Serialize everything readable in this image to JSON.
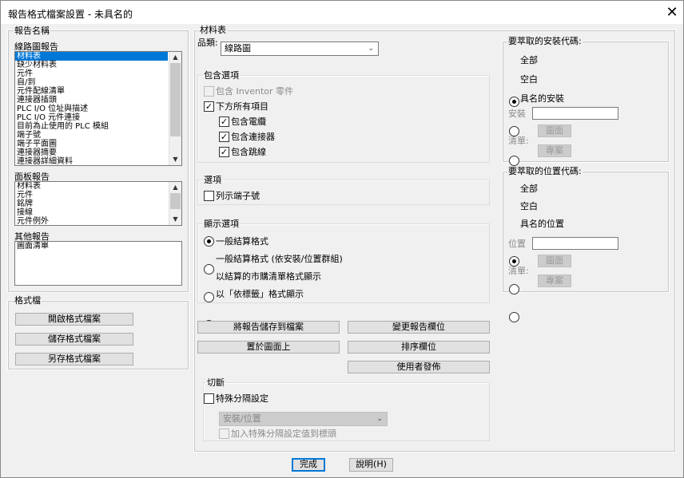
{
  "window": {
    "title": "報告格式檔案設置 - 未具名的",
    "close_glyph": "✕"
  },
  "report_names": {
    "group_label": "報告名稱",
    "circuit": {
      "label": "線路圖報告",
      "items": [
        "材料表",
        "缺少材料表",
        "元件",
        "自/到",
        "元件配線清單",
        "連接器插頭",
        "PLC I/O 位址與描述",
        "PLC I/O 元件連接",
        "目前為止使用的 PLC 模組",
        "端子號",
        "端子平面圖",
        "連接器摘要",
        "連接器詳細資料"
      ],
      "selected_index": 0
    },
    "panel": {
      "label": "面板報告",
      "items": [
        "材料表",
        "元件",
        "銘牌",
        "接線",
        "元件例外"
      ]
    },
    "other": {
      "label": "其他報告",
      "items": [
        "圖面清單"
      ]
    }
  },
  "format_file": {
    "group_label": "格式檔",
    "open": "開啟格式檔案",
    "save": "儲存格式檔案",
    "save_as": "另存格式檔案"
  },
  "bom": {
    "title": "材料表",
    "category_label": "品類:",
    "category_value": "線路圖",
    "include_group": "包含選項",
    "include_inventor": "包含 Inventor 零件",
    "include_below": "下方所有項目",
    "include_cables": "包含電纜",
    "include_connectors": "包含連接器",
    "include_jumpers": "包含跳線",
    "options_group": "選項",
    "list_terminal": "列示端子號",
    "display_group": "顯示選項",
    "display_options": [
      "一般結算格式",
      "一般結算格式 (依安裝/位置群組)",
      "以結算的市購清單格式顯示",
      "以「依標籤」格式顯示"
    ],
    "display_selected": 0
  },
  "buttons": {
    "save_report": "將報告儲存到檔案",
    "change_fields": "變更報告欄位",
    "put_on_drawing": "置於圖面上",
    "sort_fields": "排序欄位",
    "user_post": "使用者發佈"
  },
  "break": {
    "group_label": "切斷",
    "special": "特殊分隔設定",
    "select_value": "安裝/位置",
    "add_value": "加入特殊分隔設定值到標頭"
  },
  "install_codes": {
    "group_label": "要萃取的安裝代碼:",
    "options": [
      "全部",
      "空白",
      "具名的安裝"
    ],
    "selected": 0,
    "field_label": "安裝",
    "list_label": "清單:",
    "drawing_btn": "圖面",
    "project_btn": "專案"
  },
  "location_codes": {
    "group_label": "要萃取的位置代碼:",
    "options": [
      "全部",
      "空白",
      "具名的位置"
    ],
    "selected": 0,
    "field_label": "位置",
    "list_label": "清單:",
    "drawing_btn": "圖面",
    "project_btn": "專案"
  },
  "footer": {
    "done": "完成",
    "help": "說明(H)"
  },
  "check_glyph": "✓",
  "up_glyph": "▲",
  "down_glyph": "▼",
  "chev_glyph": "⌄"
}
